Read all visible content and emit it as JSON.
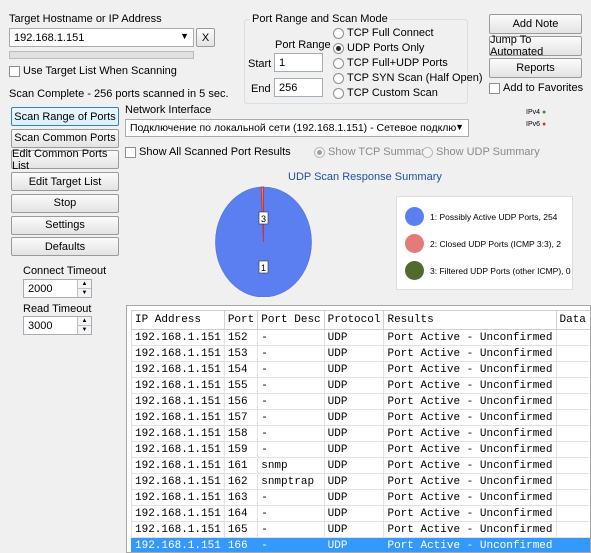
{
  "target": {
    "label": "Target Hostname or IP Address",
    "value": "192.168.1.151",
    "clear_label": "X",
    "use_target_list_label": "Use Target List When Scanning"
  },
  "status_text": "Scan Complete - 256 ports scanned in 5 sec.",
  "port_range": {
    "group_title": "Port Range and Scan Mode",
    "header": "Port Range",
    "start_label": "Start",
    "start_value": "1",
    "end_label": "End",
    "end_value": "256"
  },
  "scan_modes": [
    {
      "label": "TCP Full Connect",
      "selected": false
    },
    {
      "label": "UDP Ports Only",
      "selected": true
    },
    {
      "label": "TCP Full+UDP Ports",
      "selected": false
    },
    {
      "label": "TCP SYN Scan (Half Open)",
      "selected": false
    },
    {
      "label": "TCP Custom Scan",
      "selected": false
    }
  ],
  "right_buttons": {
    "add_note": "Add Note",
    "jump": "Jump To Automated",
    "reports": "Reports",
    "favorites_label": "Add to Favorites"
  },
  "ip_versions": {
    "ipv4": "IPv4",
    "ipv6": "IPv6"
  },
  "left_buttons": [
    "Scan Range of Ports",
    "Scan Common Ports",
    "Edit Common Ports List",
    "Edit Target List",
    "Stop",
    "Settings",
    "Defaults"
  ],
  "timeouts": {
    "connect_label": "Connect Timeout",
    "connect_value": "2000",
    "read_label": "Read Timeout",
    "read_value": "3000"
  },
  "network": {
    "label": "Network Interface",
    "value": "Подключение по локальной сети (192.168.1.151) - Сетевое подключение Ir"
  },
  "show_all_label": "Show All Scanned Port Results",
  "summary_radios": {
    "tcp": "Show TCP Summary",
    "udp": "Show UDP Summary"
  },
  "chart_data": {
    "type": "pie",
    "title": "UDP Scan Response Summary",
    "slices": [
      {
        "id": "1",
        "label": "1: Possibly Active UDP Ports, 254",
        "value": 254,
        "color": "#5b7ff0"
      },
      {
        "id": "2",
        "label": "2: Closed UDP Ports (ICMP 3:3), 2",
        "value": 2,
        "color": "#e47a7a"
      },
      {
        "id": "3",
        "label": "3: Filtered UDP Ports (other ICMP), 0",
        "value": 0,
        "color": "#4f6b2e"
      }
    ],
    "pie_labels": [
      "3",
      "1"
    ]
  },
  "table": {
    "columns": [
      "IP Address",
      "Port",
      "Port Desc",
      "Protocol",
      "Results",
      "Data Rece"
    ],
    "rows": [
      [
        "192.168.1.151",
        "152",
        "-",
        "UDP",
        "Port Active - Unconfirmed",
        ""
      ],
      [
        "192.168.1.151",
        "153",
        "-",
        "UDP",
        "Port Active - Unconfirmed",
        ""
      ],
      [
        "192.168.1.151",
        "154",
        "-",
        "UDP",
        "Port Active - Unconfirmed",
        ""
      ],
      [
        "192.168.1.151",
        "155",
        "-",
        "UDP",
        "Port Active - Unconfirmed",
        ""
      ],
      [
        "192.168.1.151",
        "156",
        "-",
        "UDP",
        "Port Active - Unconfirmed",
        ""
      ],
      [
        "192.168.1.151",
        "157",
        "-",
        "UDP",
        "Port Active - Unconfirmed",
        ""
      ],
      [
        "192.168.1.151",
        "158",
        "-",
        "UDP",
        "Port Active - Unconfirmed",
        ""
      ],
      [
        "192.168.1.151",
        "159",
        "-",
        "UDP",
        "Port Active - Unconfirmed",
        ""
      ],
      [
        "192.168.1.151",
        "161",
        "snmp",
        "UDP",
        "Port Active - Unconfirmed",
        ""
      ],
      [
        "192.168.1.151",
        "162",
        "snmptrap",
        "UDP",
        "Port Active - Unconfirmed",
        ""
      ],
      [
        "192.168.1.151",
        "163",
        "-",
        "UDP",
        "Port Active - Unconfirmed",
        ""
      ],
      [
        "192.168.1.151",
        "164",
        "-",
        "UDP",
        "Port Active - Unconfirmed",
        ""
      ],
      [
        "192.168.1.151",
        "165",
        "-",
        "UDP",
        "Port Active - Unconfirmed",
        ""
      ],
      [
        "192.168.1.151",
        "166",
        "-",
        "UDP",
        "Port Active - Unconfirmed",
        ""
      ]
    ],
    "selected_index": 13
  }
}
